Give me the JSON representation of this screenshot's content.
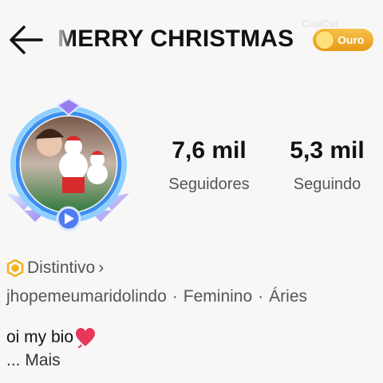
{
  "header": {
    "title": "MERRY CHRISTMAS",
    "badge_label": "Ouro",
    "watermark": "CapCut"
  },
  "stats": [
    {
      "value": "7,6 mil",
      "label": "Seguidores"
    },
    {
      "value": "5,3 mil",
      "label": "Seguindo"
    }
  ],
  "profile": {
    "distintivo_label": "Distintivo",
    "distintivo_chevron": "›",
    "username": "jhopemeumaridolindo",
    "gender": "Feminino",
    "sign": "Áries",
    "separator": "·",
    "bio": "oi my bio",
    "more": "...  Mais"
  },
  "colors": {
    "badge": "#eea427",
    "frame": "#5aa9f5",
    "heart": "#e8385a",
    "hexagon": "#f2b11c"
  },
  "icons": [
    "back-arrow-icon",
    "coin-icon",
    "hexagon-badge-icon",
    "heart-icon",
    "play-icon"
  ]
}
